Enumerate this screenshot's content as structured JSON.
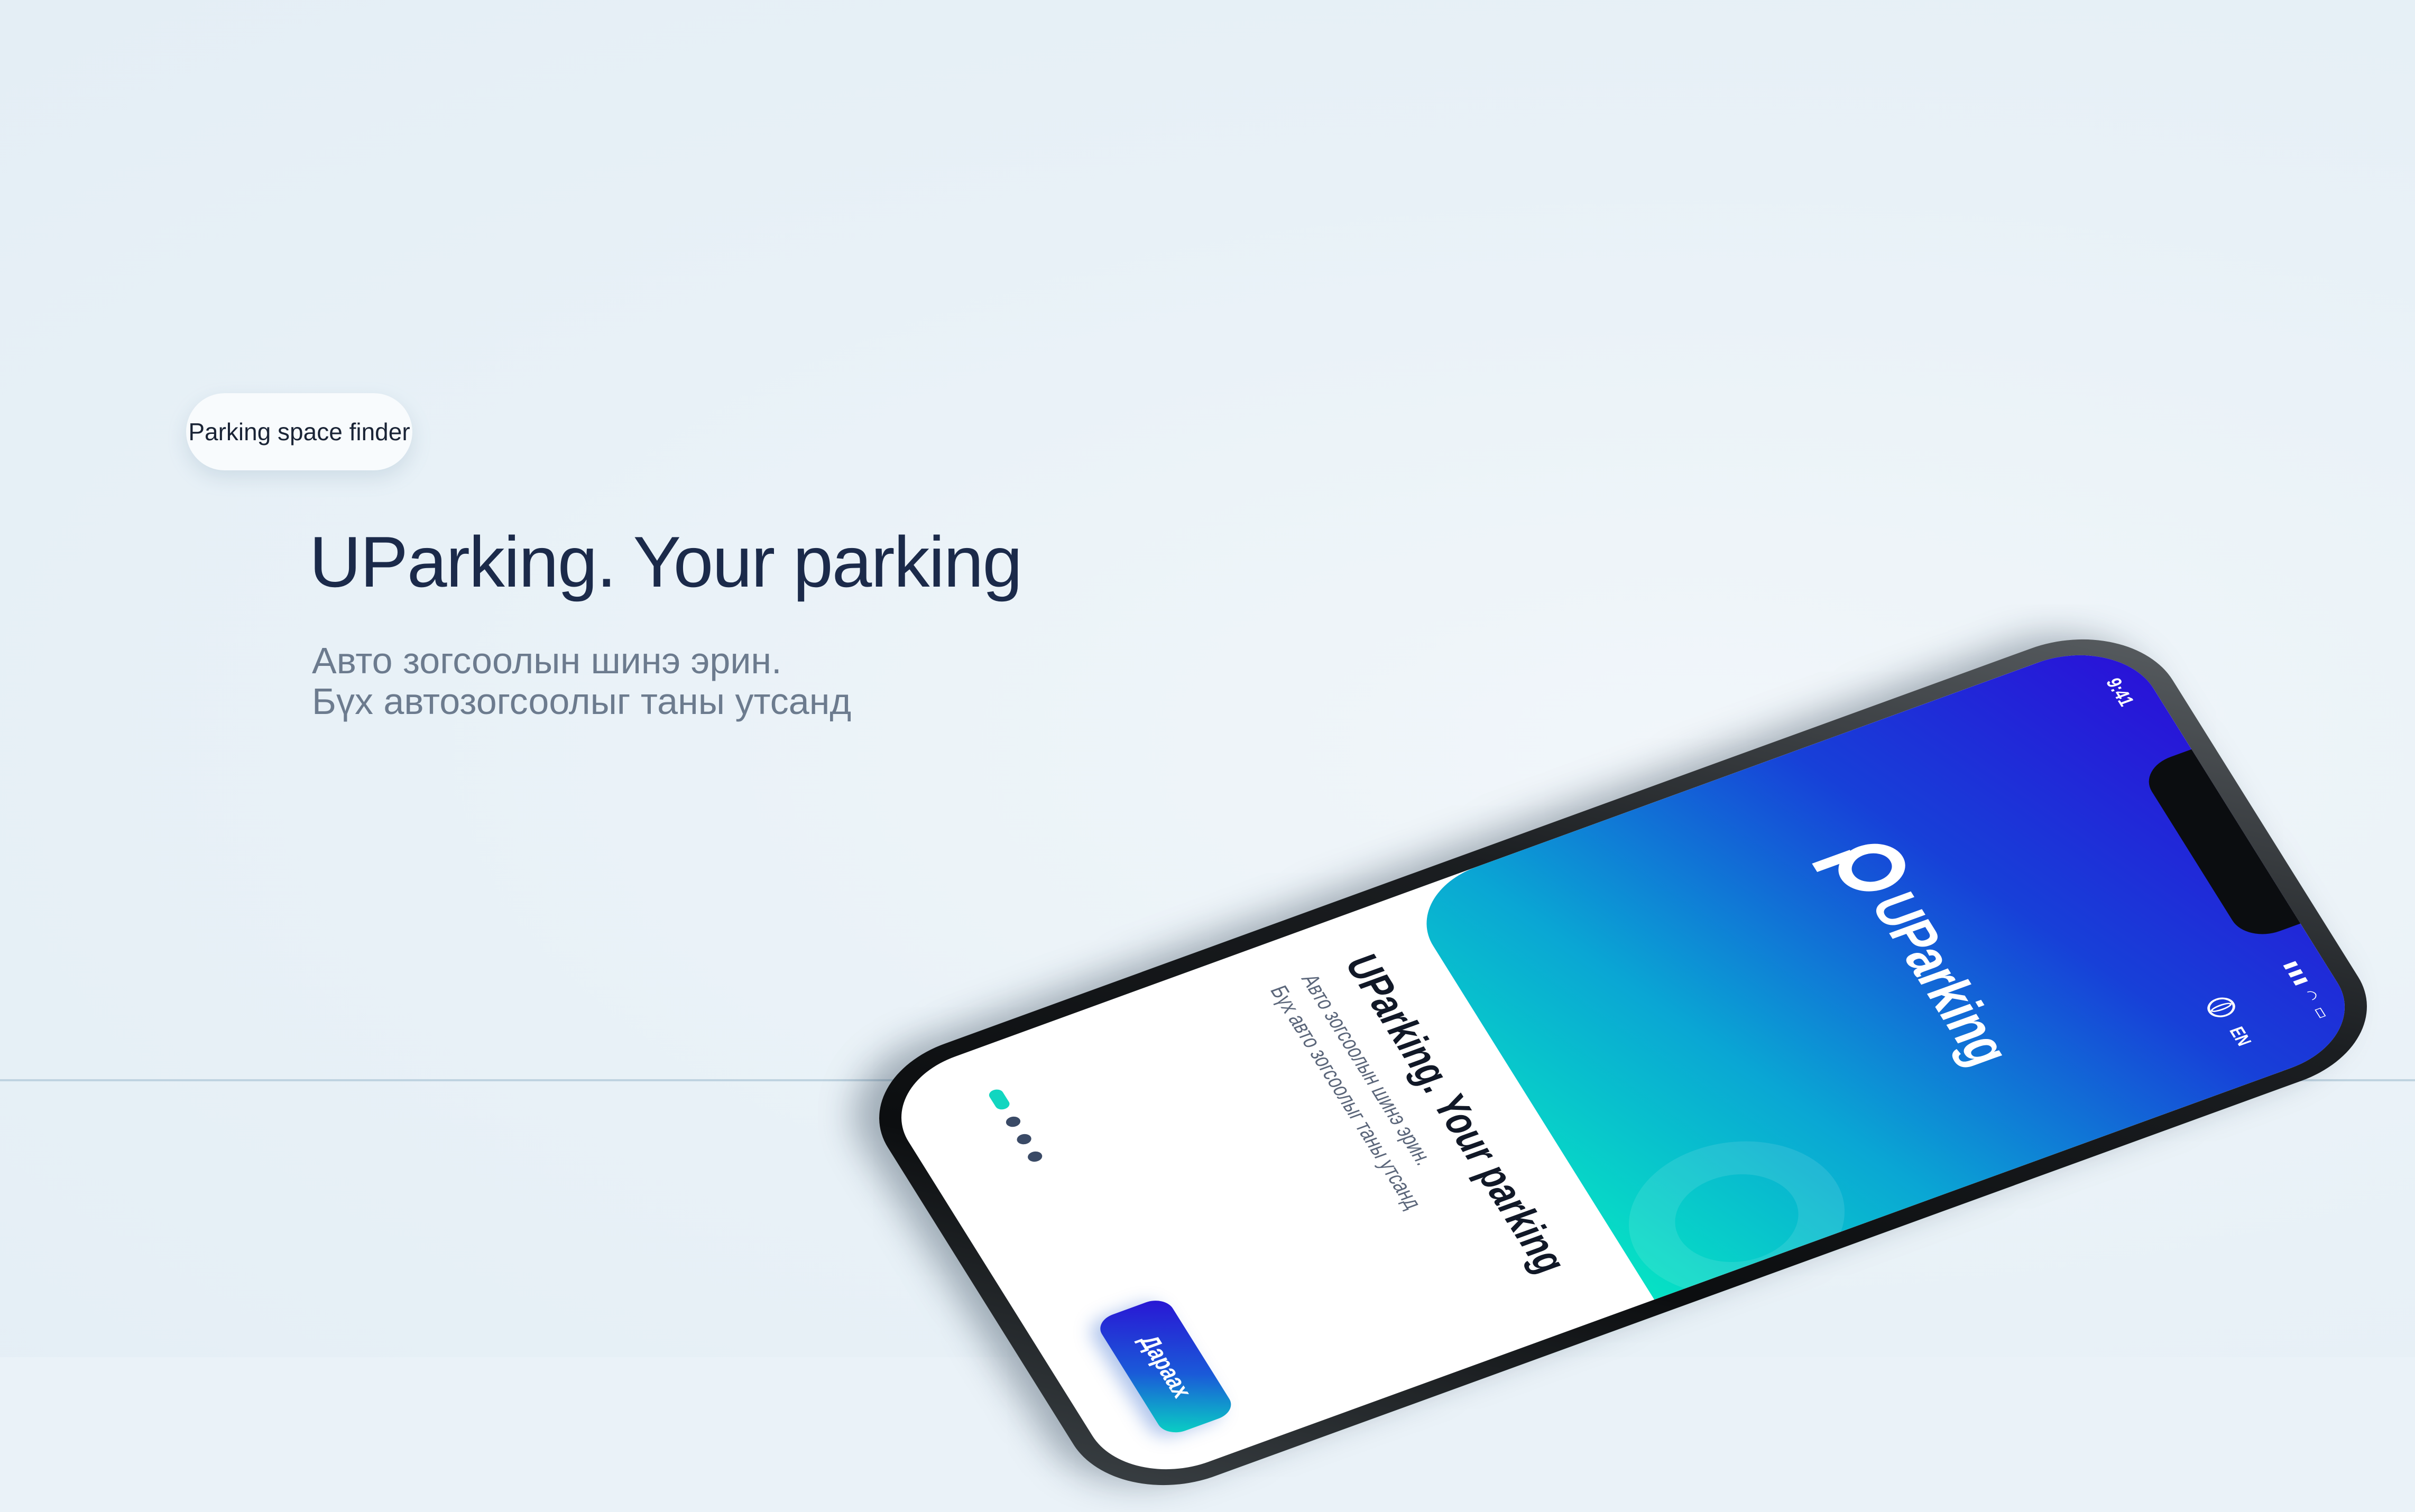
{
  "tag": "Parking space finder",
  "headline": "UParking. Your parking",
  "subtitle": {
    "line1": "Авто зогсоолын шинэ эрин.",
    "line2": "Бүх автозогсоолыг таны утсанд"
  },
  "phone": {
    "status_time": "9:41",
    "status_icons": "▮▮▮ ◠ ▭",
    "language": "EN",
    "logo_text": "UParking",
    "title": "UParking. Your parking",
    "sub_line1": "Авто зогсоолын шинэ эрин.",
    "sub_line2": "Бүх авто зогсоолыг таны утсанд",
    "next_button": "Дараах",
    "pager": {
      "total": 4,
      "active": 1
    }
  },
  "colors": {
    "background": "#eaf2f8",
    "heading": "#1b2a4a",
    "gradient_start": "#2a10d8",
    "gradient_end": "#06e2c4"
  }
}
